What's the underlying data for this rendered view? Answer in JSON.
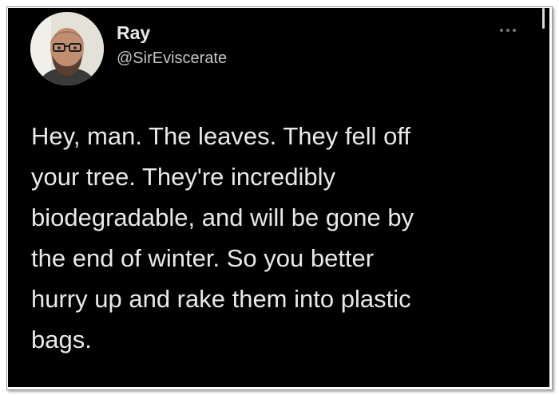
{
  "tweet": {
    "display_name": "Ray",
    "handle": "@SirEviscerate",
    "text": "Hey, man. The leaves. They fell off\nyour tree. They're incredibly\nbiodegradable, and will be gone by\nthe end of winter. So you better\nhurry up and rake them into plastic\nbags.",
    "more_icon": "more-horizontal-icon",
    "colors": {
      "background": "#000000",
      "text": "#e7e9ea",
      "secondary": "#71767b"
    }
  }
}
